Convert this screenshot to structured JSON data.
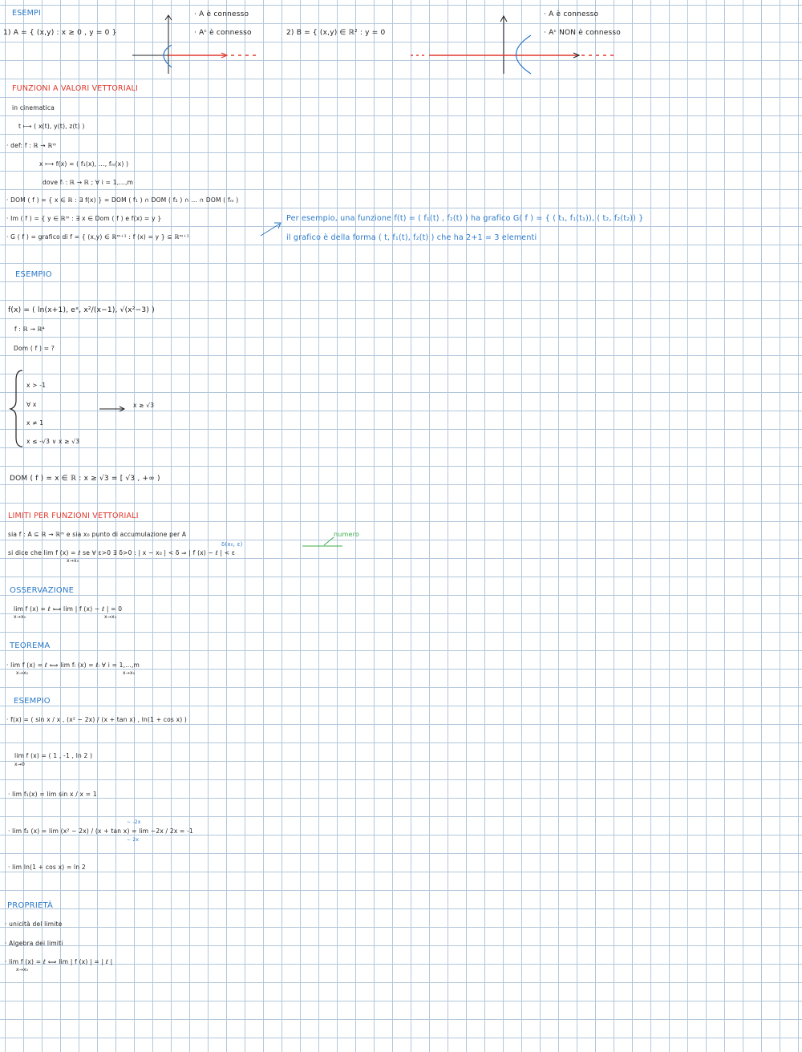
{
  "top": {
    "heading": "ESEMPI",
    "ex1": "1)  A = { (x,y) : x ≥ 0 ,  y = 0 }",
    "ex1_note1": "· A è connesso",
    "ex1_note2": "· Aᶜ è connesso",
    "ex2": "2)  B = { (x,y) ∈ ℝ² :  y = 0",
    "ex2_note1": "· A è connesso",
    "ex2_note2": "· Aᶜ NON è connesso"
  },
  "vect": {
    "heading": "FUNZIONI A VALORI VETTORIALI",
    "l1": "in cinematica",
    "l2": "t ⟼ ( x(t), y(t), z(t) )",
    "l3": "· def:   f : ℝ → ℝᵐ",
    "l4": "x ⟼ f(x) = ( f₁(x), ..., fₘ(x) )",
    "l5": "dove  fᵢ : ℝ → ℝ ;   ∀ i = 1,...,m",
    "l6": "·   DOM ( f ) = { x ∈ ℝ : ∃ f(x) } = DOM ( f₁ ) ∩ DOM ( f₂ ) ∩ ... ∩ DOM ( fₘ )",
    "l7": "· Im ( f ) = { y ∈ ℝᵐ : ∃ x ∈ Dom ( f ) e f(x) = y }",
    "l8": "· G ( f ) = grafico di f  =  { (x,y) ∈ ℝᵐ⁺¹ :  f (x) = y } ⊆ ℝᵐ⁺¹",
    "note1": "Per esempio, una funzione   f(t) = ( f₁(t) , f₂(t) )   ha grafico  G( f ) = { ( t₁, f₁(t₁)), ( t₂, f₂(t₂)) }",
    "note2": "il grafico è della forma   ( t, f₁(t), f₂(t) )   che ha  2+1 = 3  elementi"
  },
  "es1": {
    "heading": "ESEMPIO",
    "f": "f(x) = ( ln(x+1),  eˣ,  x²/(x−1),  √(x²−3) )",
    "map": "f : ℝ → ℝ⁴",
    "dom": "Dom ( f ) = ?",
    "c1": "x > -1",
    "c2": "∀ x",
    "c3": "x ≠ 1",
    "c4": "x ≤ -√3  ∨  x ≥ √3",
    "res": "x ≥ √3",
    "final": "DOM ( f ) =  x ∈ ℝ :  x ≥ √3  =  [ √3 , +∞ )"
  },
  "lim": {
    "heading": "LIMITI PER FUNZIONI VETTORIALI",
    "l1": "sia  f : A ⊆ ℝ → ℝᵐ   e  sia  x₀  punto di  accumulazione  per A",
    "l2": "si dice  che  lim    f (x) = ℓ   se     ∀ ε>0   ∃ δ>0 :  | x − x₀ | < δ  ⇒  | f (x) − ℓ | < ε",
    "sub": "x→x₀",
    "delta": "δ(x₀, ε)",
    "numero": "numero"
  },
  "oss": {
    "heading": "OSSERVAZIONE",
    "l1": "lim   f (x) = ℓ   ⟺   lim   | f (x) − ℓ | = 0",
    "sub1": "x→x₀",
    "sub2": "x→x₀"
  },
  "teo": {
    "heading": "TEOREMA",
    "l1": "·  lim   f (x) =  ℓ      ⟺    lim    fᵢ (x) = ℓᵢ   ∀ i = 1,...,m",
    "sub1": "x→x₀",
    "sub2": "x→x₀"
  },
  "es2": {
    "heading": "ESEMPIO",
    "f": "· f(x) = ( sin x / x ,   (x² − 2x) / (x + tan x) ,   ln(1 + cos x) )",
    "lim": "lim  f (x)  =   ( 1 , -1 ,  ln 2 )",
    "sub": "x→0",
    "l1": "·   lim  f₁(x) =  lim   sin x / x   = 1",
    "l2": "·  lim  f₂ (x) =  lim     (x² − 2x) / (x + tan x)   =   lim   −2x / 2x   =  -1",
    "l3": "·   lim   ln(1 + cos x)  =  ln 2",
    "ann_top": "∼ -2x",
    "ann_bot": "∼ 2x"
  },
  "prop": {
    "heading": "PROPRIETÀ",
    "l1": "· unicità del limite",
    "l2": "· Algebra dei limiti",
    "l3": "·   lim  f (x) = ℓ   ⟺  lim   | f (x) | = | ℓ |",
    "sub": "x→x₀"
  }
}
